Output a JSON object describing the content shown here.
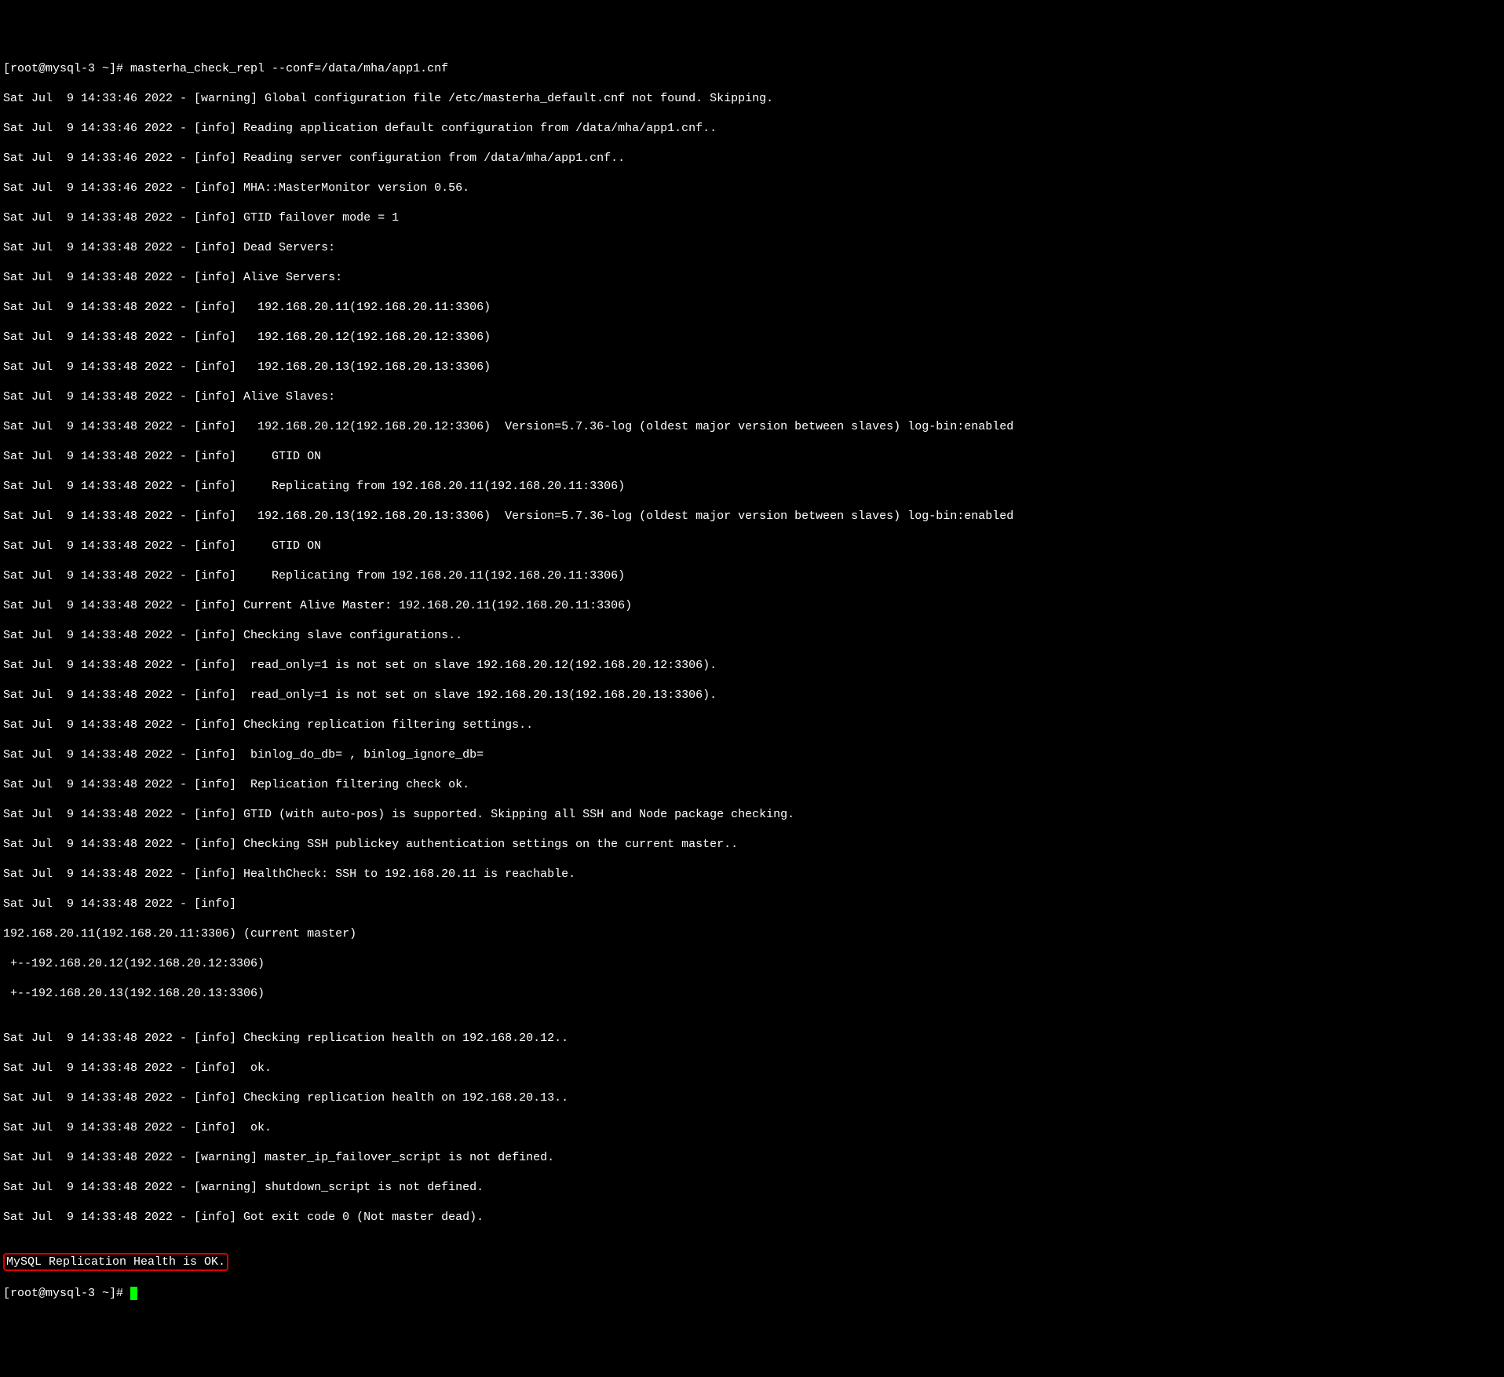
{
  "prompt1": "[root@mysql-3 ~]# ",
  "command1": "masterha_check_repl --conf=/data/mha/app1.cnf",
  "log": [
    "Sat Jul  9 14:33:46 2022 - [warning] Global configuration file /etc/masterha_default.cnf not found. Skipping.",
    "Sat Jul  9 14:33:46 2022 - [info] Reading application default configuration from /data/mha/app1.cnf..",
    "Sat Jul  9 14:33:46 2022 - [info] Reading server configuration from /data/mha/app1.cnf..",
    "Sat Jul  9 14:33:46 2022 - [info] MHA::MasterMonitor version 0.56.",
    "Sat Jul  9 14:33:48 2022 - [info] GTID failover mode = 1",
    "Sat Jul  9 14:33:48 2022 - [info] Dead Servers:",
    "Sat Jul  9 14:33:48 2022 - [info] Alive Servers:",
    "Sat Jul  9 14:33:48 2022 - [info]   192.168.20.11(192.168.20.11:3306)",
    "Sat Jul  9 14:33:48 2022 - [info]   192.168.20.12(192.168.20.12:3306)",
    "Sat Jul  9 14:33:48 2022 - [info]   192.168.20.13(192.168.20.13:3306)",
    "Sat Jul  9 14:33:48 2022 - [info] Alive Slaves:",
    "Sat Jul  9 14:33:48 2022 - [info]   192.168.20.12(192.168.20.12:3306)  Version=5.7.36-log (oldest major version between slaves) log-bin:enabled",
    "Sat Jul  9 14:33:48 2022 - [info]     GTID ON",
    "Sat Jul  9 14:33:48 2022 - [info]     Replicating from 192.168.20.11(192.168.20.11:3306)",
    "Sat Jul  9 14:33:48 2022 - [info]   192.168.20.13(192.168.20.13:3306)  Version=5.7.36-log (oldest major version between slaves) log-bin:enabled",
    "Sat Jul  9 14:33:48 2022 - [info]     GTID ON",
    "Sat Jul  9 14:33:48 2022 - [info]     Replicating from 192.168.20.11(192.168.20.11:3306)",
    "Sat Jul  9 14:33:48 2022 - [info] Current Alive Master: 192.168.20.11(192.168.20.11:3306)",
    "Sat Jul  9 14:33:48 2022 - [info] Checking slave configurations..",
    "Sat Jul  9 14:33:48 2022 - [info]  read_only=1 is not set on slave 192.168.20.12(192.168.20.12:3306).",
    "Sat Jul  9 14:33:48 2022 - [info]  read_only=1 is not set on slave 192.168.20.13(192.168.20.13:3306).",
    "Sat Jul  9 14:33:48 2022 - [info] Checking replication filtering settings..",
    "Sat Jul  9 14:33:48 2022 - [info]  binlog_do_db= , binlog_ignore_db=",
    "Sat Jul  9 14:33:48 2022 - [info]  Replication filtering check ok.",
    "Sat Jul  9 14:33:48 2022 - [info] GTID (with auto-pos) is supported. Skipping all SSH and Node package checking.",
    "Sat Jul  9 14:33:48 2022 - [info] Checking SSH publickey authentication settings on the current master..",
    "Sat Jul  9 14:33:48 2022 - [info] HealthCheck: SSH to 192.168.20.11 is reachable.",
    "Sat Jul  9 14:33:48 2022 - [info]",
    "192.168.20.11(192.168.20.11:3306) (current master)",
    " +--192.168.20.12(192.168.20.12:3306)",
    " +--192.168.20.13(192.168.20.13:3306)",
    "",
    "Sat Jul  9 14:33:48 2022 - [info] Checking replication health on 192.168.20.12..",
    "Sat Jul  9 14:33:48 2022 - [info]  ok.",
    "Sat Jul  9 14:33:48 2022 - [info] Checking replication health on 192.168.20.13..",
    "Sat Jul  9 14:33:48 2022 - [info]  ok.",
    "Sat Jul  9 14:33:48 2022 - [warning] master_ip_failover_script is not defined.",
    "Sat Jul  9 14:33:48 2022 - [warning] shutdown_script is not defined.",
    "Sat Jul  9 14:33:48 2022 - [info] Got exit code 0 (Not master dead).",
    ""
  ],
  "result_line": "MySQL Replication Health is OK.",
  "prompt2": "[root@mysql-3 ~]# "
}
